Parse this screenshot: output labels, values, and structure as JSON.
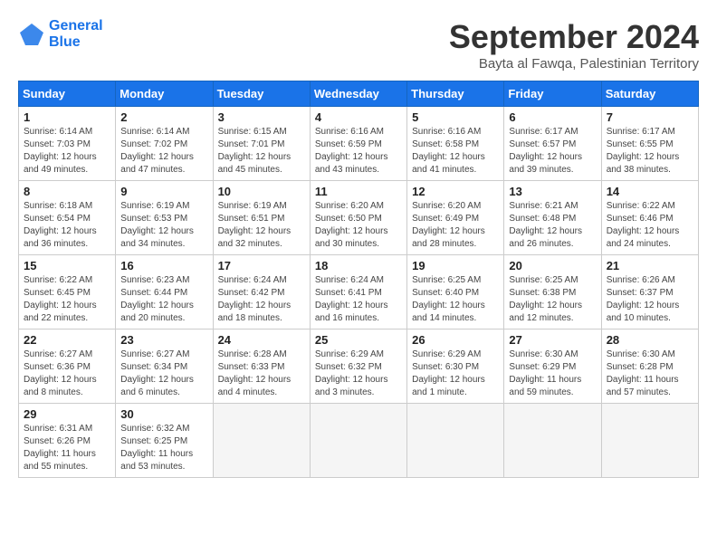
{
  "header": {
    "logo_line1": "General",
    "logo_line2": "Blue",
    "month_title": "September 2024",
    "subtitle": "Bayta al Fawqa, Palestinian Territory"
  },
  "columns": [
    "Sunday",
    "Monday",
    "Tuesday",
    "Wednesday",
    "Thursday",
    "Friday",
    "Saturday"
  ],
  "weeks": [
    [
      {
        "day": "1",
        "info": "Sunrise: 6:14 AM\nSunset: 7:03 PM\nDaylight: 12 hours\nand 49 minutes."
      },
      {
        "day": "2",
        "info": "Sunrise: 6:14 AM\nSunset: 7:02 PM\nDaylight: 12 hours\nand 47 minutes."
      },
      {
        "day": "3",
        "info": "Sunrise: 6:15 AM\nSunset: 7:01 PM\nDaylight: 12 hours\nand 45 minutes."
      },
      {
        "day": "4",
        "info": "Sunrise: 6:16 AM\nSunset: 6:59 PM\nDaylight: 12 hours\nand 43 minutes."
      },
      {
        "day": "5",
        "info": "Sunrise: 6:16 AM\nSunset: 6:58 PM\nDaylight: 12 hours\nand 41 minutes."
      },
      {
        "day": "6",
        "info": "Sunrise: 6:17 AM\nSunset: 6:57 PM\nDaylight: 12 hours\nand 39 minutes."
      },
      {
        "day": "7",
        "info": "Sunrise: 6:17 AM\nSunset: 6:55 PM\nDaylight: 12 hours\nand 38 minutes."
      }
    ],
    [
      {
        "day": "8",
        "info": "Sunrise: 6:18 AM\nSunset: 6:54 PM\nDaylight: 12 hours\nand 36 minutes."
      },
      {
        "day": "9",
        "info": "Sunrise: 6:19 AM\nSunset: 6:53 PM\nDaylight: 12 hours\nand 34 minutes."
      },
      {
        "day": "10",
        "info": "Sunrise: 6:19 AM\nSunset: 6:51 PM\nDaylight: 12 hours\nand 32 minutes."
      },
      {
        "day": "11",
        "info": "Sunrise: 6:20 AM\nSunset: 6:50 PM\nDaylight: 12 hours\nand 30 minutes."
      },
      {
        "day": "12",
        "info": "Sunrise: 6:20 AM\nSunset: 6:49 PM\nDaylight: 12 hours\nand 28 minutes."
      },
      {
        "day": "13",
        "info": "Sunrise: 6:21 AM\nSunset: 6:48 PM\nDaylight: 12 hours\nand 26 minutes."
      },
      {
        "day": "14",
        "info": "Sunrise: 6:22 AM\nSunset: 6:46 PM\nDaylight: 12 hours\nand 24 minutes."
      }
    ],
    [
      {
        "day": "15",
        "info": "Sunrise: 6:22 AM\nSunset: 6:45 PM\nDaylight: 12 hours\nand 22 minutes."
      },
      {
        "day": "16",
        "info": "Sunrise: 6:23 AM\nSunset: 6:44 PM\nDaylight: 12 hours\nand 20 minutes."
      },
      {
        "day": "17",
        "info": "Sunrise: 6:24 AM\nSunset: 6:42 PM\nDaylight: 12 hours\nand 18 minutes."
      },
      {
        "day": "18",
        "info": "Sunrise: 6:24 AM\nSunset: 6:41 PM\nDaylight: 12 hours\nand 16 minutes."
      },
      {
        "day": "19",
        "info": "Sunrise: 6:25 AM\nSunset: 6:40 PM\nDaylight: 12 hours\nand 14 minutes."
      },
      {
        "day": "20",
        "info": "Sunrise: 6:25 AM\nSunset: 6:38 PM\nDaylight: 12 hours\nand 12 minutes."
      },
      {
        "day": "21",
        "info": "Sunrise: 6:26 AM\nSunset: 6:37 PM\nDaylight: 12 hours\nand 10 minutes."
      }
    ],
    [
      {
        "day": "22",
        "info": "Sunrise: 6:27 AM\nSunset: 6:36 PM\nDaylight: 12 hours\nand 8 minutes."
      },
      {
        "day": "23",
        "info": "Sunrise: 6:27 AM\nSunset: 6:34 PM\nDaylight: 12 hours\nand 6 minutes."
      },
      {
        "day": "24",
        "info": "Sunrise: 6:28 AM\nSunset: 6:33 PM\nDaylight: 12 hours\nand 4 minutes."
      },
      {
        "day": "25",
        "info": "Sunrise: 6:29 AM\nSunset: 6:32 PM\nDaylight: 12 hours\nand 3 minutes."
      },
      {
        "day": "26",
        "info": "Sunrise: 6:29 AM\nSunset: 6:30 PM\nDaylight: 12 hours\nand 1 minute."
      },
      {
        "day": "27",
        "info": "Sunrise: 6:30 AM\nSunset: 6:29 PM\nDaylight: 11 hours\nand 59 minutes."
      },
      {
        "day": "28",
        "info": "Sunrise: 6:30 AM\nSunset: 6:28 PM\nDaylight: 11 hours\nand 57 minutes."
      }
    ],
    [
      {
        "day": "29",
        "info": "Sunrise: 6:31 AM\nSunset: 6:26 PM\nDaylight: 11 hours\nand 55 minutes."
      },
      {
        "day": "30",
        "info": "Sunrise: 6:32 AM\nSunset: 6:25 PM\nDaylight: 11 hours\nand 53 minutes."
      },
      {
        "day": "",
        "info": ""
      },
      {
        "day": "",
        "info": ""
      },
      {
        "day": "",
        "info": ""
      },
      {
        "day": "",
        "info": ""
      },
      {
        "day": "",
        "info": ""
      }
    ]
  ]
}
